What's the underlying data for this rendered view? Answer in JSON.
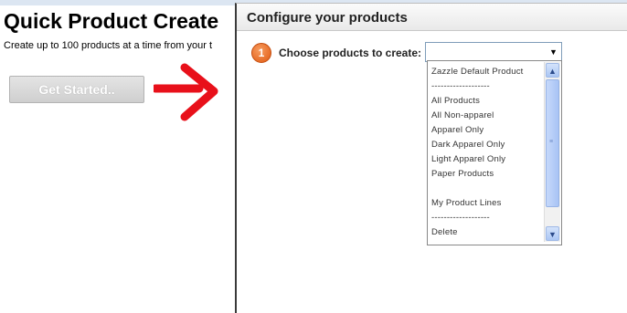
{
  "background": {
    "title": "Quick Product Create",
    "subtitle": "Create up to 100 products at a time from your t",
    "get_started_label": "Get Started.."
  },
  "dialog": {
    "title": "Configure your products",
    "step_number": "1",
    "step_label": "Choose products to create:",
    "select_value": "",
    "dropdown_options": [
      "Zazzle Default Product",
      "-------------------",
      "All Products",
      "All Non-apparel",
      "Apparel Only",
      "Dark Apparel Only",
      "Light Apparel Only",
      "Paper Products",
      "",
      "My Product Lines",
      "-------------------",
      "Delete"
    ]
  },
  "colors": {
    "arrow": "#e8101a",
    "step_badge": "#e8661f",
    "scrollbar": "#b4cdf6"
  },
  "icons": {
    "annotation": "red-arrow-icon",
    "dropdown": "chevron-down-icon",
    "scroll_up": "scroll-up-icon",
    "scroll_down": "scroll-down-icon"
  }
}
